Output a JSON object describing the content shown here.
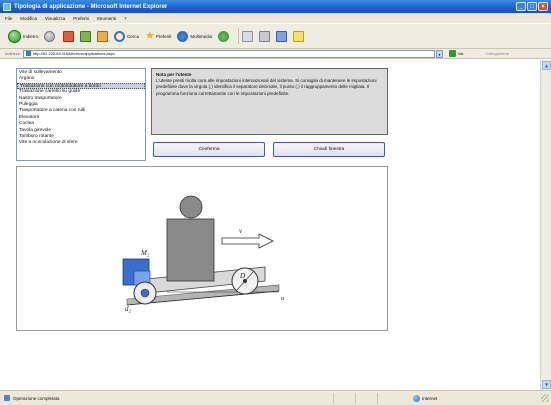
{
  "window": {
    "title": "Tipologia di applicazione - Microsoft Internet Explorer",
    "controls": [
      "_",
      "□",
      "×"
    ]
  },
  "menubar": [
    "File",
    "Modifica",
    "Visualizza",
    "Preferiti",
    "Strumenti",
    "?"
  ],
  "toolbar": {
    "back_label": "Indietro",
    "search_label": "Cerca",
    "favorites_label": "Preferiti",
    "media_label": "Multimedia"
  },
  "address": {
    "label": "Indirizzo",
    "value": "http://62.220.64.115/kit/drive/applications.aspx",
    "go_label": "Vai",
    "links_label": "Collegamenti"
  },
  "app_list": {
    "items": [
      "Vite di sollevamento",
      "Argano",
      "Traslazione con motoriduttore a bordo",
      "Traslazione carrello su guide",
      "Nastro trasportatore",
      "Puleggia",
      "Trasportatore a catena con rulli",
      "Elevatore",
      "Coclea",
      "Tavola girevole",
      "Tamburo rotante",
      "Vite a ricircolazione di sfere"
    ],
    "selected_index": 2
  },
  "note": {
    "title": "Nota per l'utente",
    "body": "L'utente presti molta cura alle impostazioni internazionali del sistema. Si consiglia di mantenere le impostazioni predefinite dove la virgola (,) identifica il separatore decimale, il punto (.) il raggruppamento delle migliaia. Il programma funziona correttamente con le impostazioni predefinite."
  },
  "buttons": {
    "confirm": "Conferma",
    "close_window": "Chiudi finestra"
  },
  "diagram": {
    "labels": {
      "velocity": "v",
      "motor": "M₂",
      "wheel_diameter": "D",
      "drive_wheel": "d₂",
      "slope_angle": "α"
    },
    "colors": {
      "load": "#8a8a8a",
      "motor": "#3a6fd0",
      "carriage": "#d9d9d9",
      "ground": "#b4b4b4"
    }
  },
  "status": {
    "text": "Operazione completata",
    "zone": "Internet"
  }
}
